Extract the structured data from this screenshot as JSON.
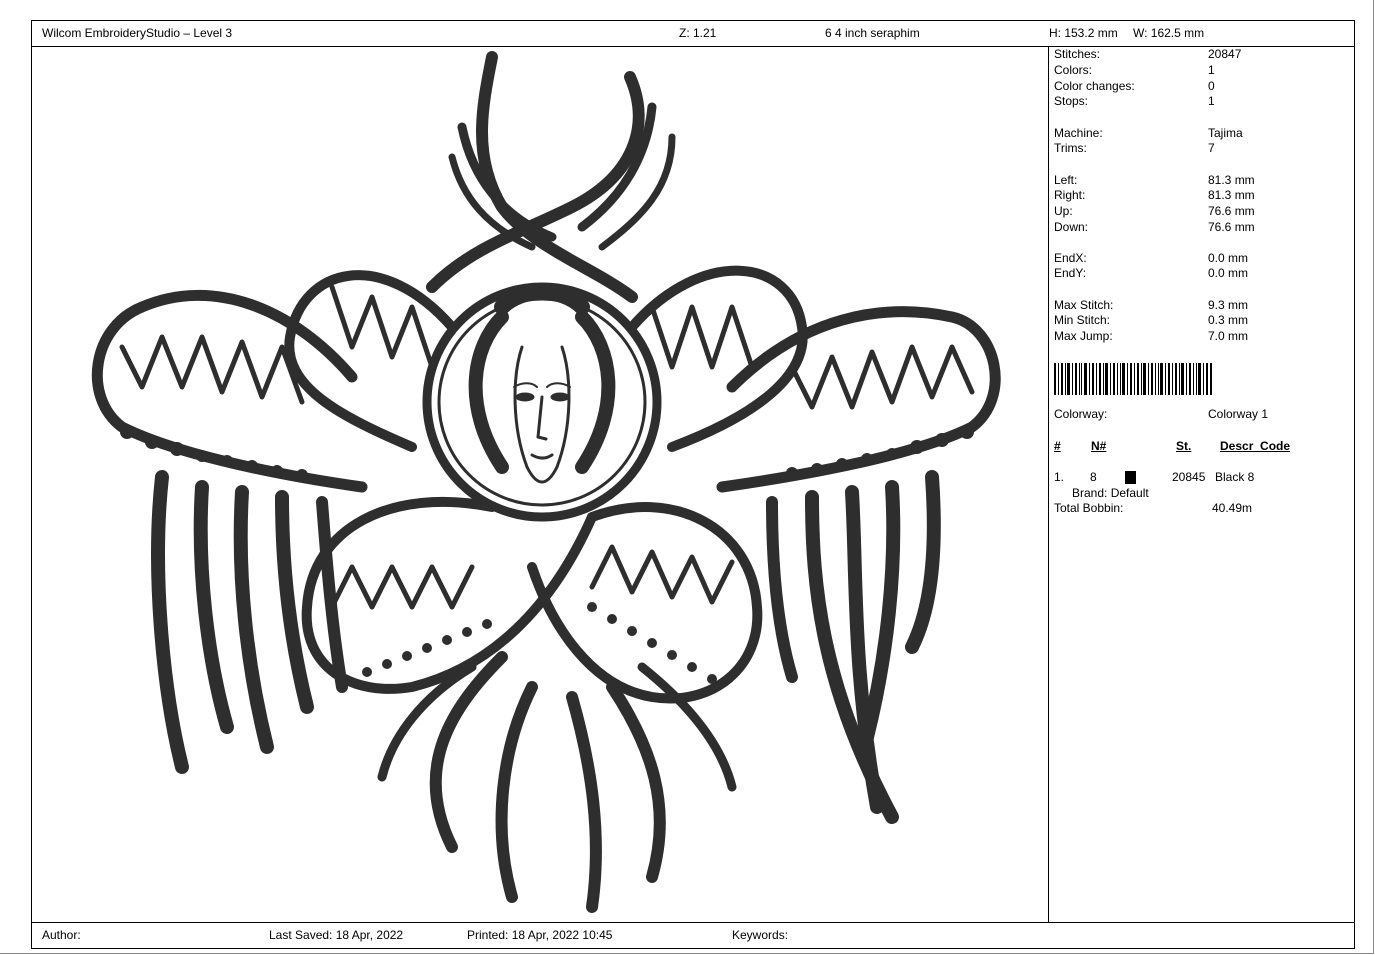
{
  "header": {
    "app_title": "Wilcom EmbroideryStudio – Level 3",
    "zoom": "Z: 1.21",
    "design_name": "6  4 inch seraphim",
    "height": "H: 153.2 mm",
    "width": "W: 162.5 mm"
  },
  "stats": [
    {
      "label": "Stitches:",
      "value": "20847"
    },
    {
      "label": "Colors:",
      "value": "1"
    },
    {
      "label": "Color changes:",
      "value": "0"
    },
    {
      "label": "Stops:",
      "value": "1"
    },
    {
      "label": "Machine:",
      "value": "Tajima"
    },
    {
      "label": "Trims:",
      "value": "7"
    },
    {
      "label": "Left:",
      "value": "81.3 mm"
    },
    {
      "label": "Right:",
      "value": "81.3 mm"
    },
    {
      "label": "Up:",
      "value": "76.6 mm"
    },
    {
      "label": "Down:",
      "value": "76.6 mm"
    },
    {
      "label": "EndX:",
      "value": "0.0 mm"
    },
    {
      "label": "EndY:",
      "value": "0.0 mm"
    },
    {
      "label": "Max Stitch:",
      "value": "9.3 mm"
    },
    {
      "label": "Min Stitch:",
      "value": "0.3 mm"
    },
    {
      "label": "Max Jump:",
      "value": "7.0 mm"
    }
  ],
  "colorway": {
    "label": "Colorway:",
    "value": "Colorway 1"
  },
  "color_table": {
    "headers": [
      "#",
      "N#",
      "St.",
      "Descr_Code"
    ],
    "rows": [
      {
        "index": "1.",
        "needle": "8",
        "swatch_color": "#000000",
        "stitches": "20845",
        "description": "Black 8",
        "brand": "Brand: Default"
      }
    ]
  },
  "total_bobbin": {
    "label": "Total Bobbin:",
    "value": "40.49m"
  },
  "footer": {
    "author": "Author:",
    "last_saved": "Last Saved: 18 Apr, 2022",
    "printed": "Printed: 18 Apr, 2022 10:45",
    "keywords": "Keywords:"
  },
  "design_thread_color": "#2e2e2e"
}
